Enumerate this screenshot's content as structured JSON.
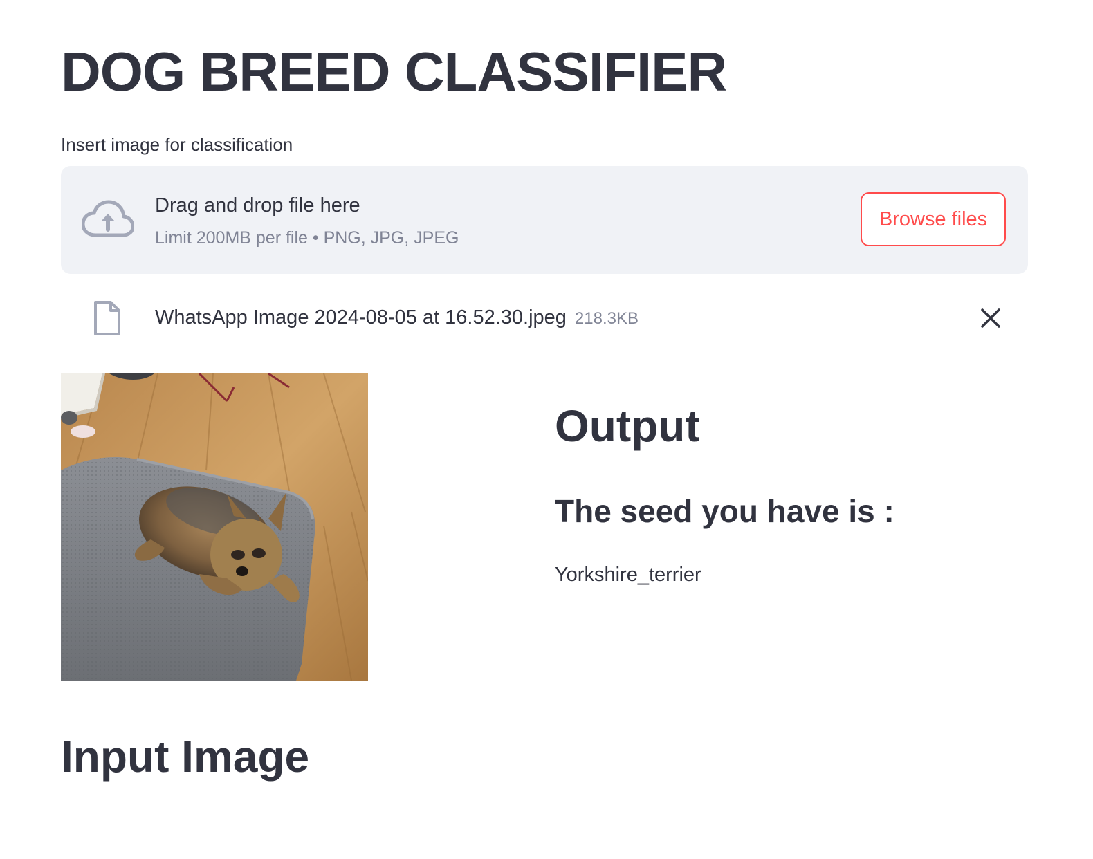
{
  "app": {
    "title": "DOG BREED CLASSIFIER"
  },
  "uploader": {
    "label": "Insert image for classification",
    "dropzone_title": "Drag and drop file here",
    "dropzone_limit": "Limit 200MB per file • PNG, JPG, JPEG",
    "browse_label": "Browse files",
    "icon": "cloud-upload-icon"
  },
  "uploaded_file": {
    "name": "WhatsApp Image 2024-08-05 at 16.52.30.jpeg",
    "size": "218.3KB",
    "icon": "file-icon",
    "remove_icon": "close-icon"
  },
  "result": {
    "output_heading": "Output",
    "seed_heading": "The seed you have is :",
    "prediction": "Yorkshire_terrier"
  },
  "input_section": {
    "heading": "Input Image"
  },
  "colors": {
    "accent": "#ff4b4b",
    "text": "#31333f",
    "muted": "#808495",
    "dropzone_bg": "#f0f2f6"
  }
}
